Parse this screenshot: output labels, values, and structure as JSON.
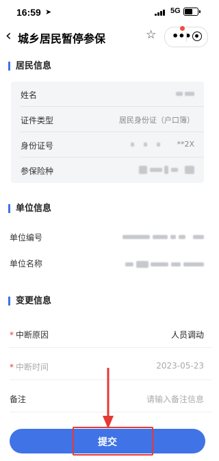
{
  "status_bar": {
    "time": "16:59",
    "network": "5G"
  },
  "nav": {
    "title": "城乡居民暂停参保"
  },
  "sections": {
    "resident": "居民信息",
    "unit": "单位信息",
    "change": "变更信息"
  },
  "resident_info": [
    {
      "label": "姓名",
      "value": ""
    },
    {
      "label": "证件类型",
      "value": "居民身份证（户口簿）"
    },
    {
      "label": "身份证号",
      "value": "**2X"
    },
    {
      "label": "参保险种",
      "value": ""
    }
  ],
  "unit_info": [
    {
      "label": "单位编号",
      "value": ""
    },
    {
      "label": "单位名称",
      "value": ""
    }
  ],
  "change_info": {
    "reason_label": "中断原因",
    "reason_value": "人员调动",
    "time_label": "中断时间",
    "time_value": "2023-05-23",
    "note_label": "备注",
    "note_placeholder": "请输入备注信息"
  },
  "submit_label": "提交",
  "colors": {
    "accent": "#3f73e6",
    "annotation": "#e53935"
  }
}
